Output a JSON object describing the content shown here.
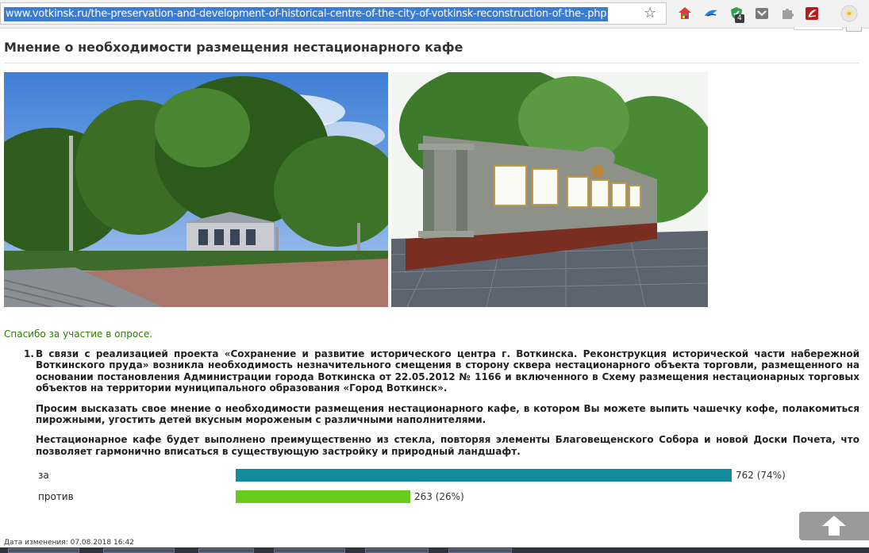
{
  "browser": {
    "url": "www.votkinsk.ru/the-preservation-and-development-of-historical-centre-of-the-city-of-votkinsk-reconstruction-of-the-.php",
    "extension_badge": "4",
    "icons": [
      "star-icon",
      "multicolor-extension-icon",
      "bird-extension-icon",
      "shield-extension-icon",
      "mail-extension-icon",
      "puzzle-extension-icon",
      "pdf-extension-icon",
      "profile-icon"
    ]
  },
  "page": {
    "title": "Мнение о необходимости размещения нестационарного кафе",
    "thanks": "Спасибо за участие в опросе."
  },
  "question": {
    "number": "1.",
    "paragraphs": [
      "В связи с реализацией проекта «Сохранение и развитие исторического центра г. Воткинска. Реконструкция исторической части набережной Воткинского пруда» возникла необходимость незначительного смещения в сторону сквера нестационарного объекта торговли, размещенного на основании постановления Администрации города Воткинска от 22.05.2012 № 1166 и включенного в Схему размещения нестационарных торговых объектов на территории муниципального образования «Город Воткинск».",
      "Просим высказать свое мнение о необходимости размещения нестационарного кафе, в котором Вы можете выпить чашечку кофе, полакомиться пирожными, угостить детей вкусным мороженым с различными наполнителями.",
      "Нестационарное кафе будет выполнено преимущественно из стекла, повторяя элементы Благовещенского Собора и новой Доски Почета, что позволяет гармонично вписаться в существующую застройку и природный ландшафт."
    ]
  },
  "options": [
    {
      "label": "за",
      "value_text": "762 (74%)",
      "percent": 74,
      "color": "#138a9e"
    },
    {
      "label": "против",
      "value_text": "263 (26%)",
      "percent": 26,
      "color": "#66cc1a"
    }
  ],
  "footer": {
    "date": "Дата изменения: 07.08.2018 16:42"
  }
}
